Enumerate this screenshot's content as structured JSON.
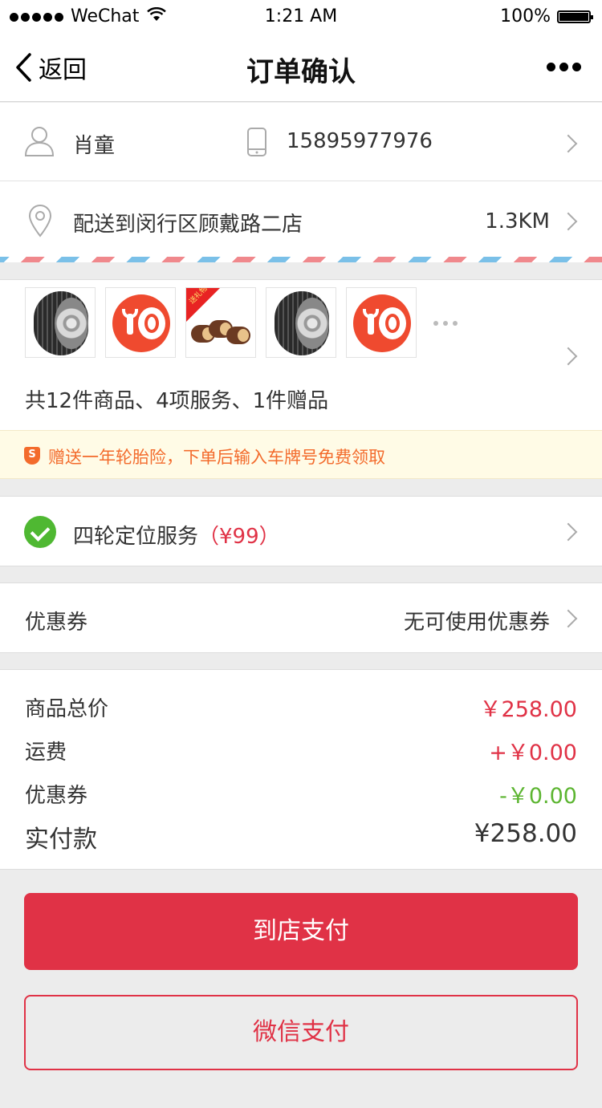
{
  "status_bar": {
    "carrier": "WeChat",
    "time": "1:21 AM",
    "battery": "100%"
  },
  "nav": {
    "back_label": "返回",
    "title": "订单确认"
  },
  "contact": {
    "name": "肖童",
    "phone": "15895977976"
  },
  "delivery": {
    "address": "配送到闵行区顾戴路二店",
    "distance": "1.3KM"
  },
  "products": {
    "thumbnails": [
      "tire-image",
      "tire-service-icon",
      "gift-image",
      "tire-image",
      "tire-service-icon"
    ],
    "gift_ribbon": "送礼物",
    "summary": "共12件商品、4项服务、1件赠品"
  },
  "notice": {
    "icon_text": "S",
    "text": "赠送一年轮胎险，下单后输入车牌号免费领取"
  },
  "service": {
    "label": "四轮定位服务",
    "price": "（¥99）"
  },
  "coupon": {
    "label": "优惠券",
    "value": "无可使用优惠券"
  },
  "summary": [
    {
      "label": "商品总价",
      "value": "￥258.00",
      "color": "#e03246"
    },
    {
      "label": "运费",
      "value": "+￥0.00",
      "color": "#e03246"
    },
    {
      "label": "优惠券",
      "value": "-￥0.00",
      "color": "#5cb531"
    },
    {
      "label": "实付款",
      "value": "¥258.00",
      "color": "#333333"
    }
  ],
  "buttons": {
    "pay_in_store": "到店支付",
    "wechat_pay": "微信支付"
  }
}
